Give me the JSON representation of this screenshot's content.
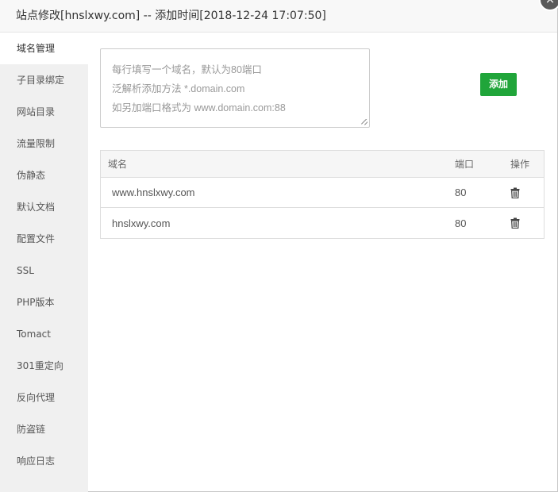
{
  "dialog": {
    "title": "站点修改[hnslxwy.com] -- 添加时间[2018-12-24 17:07:50]",
    "close_icon": "close-icon",
    "close_glyph": "×"
  },
  "sidebar": {
    "items": [
      {
        "label": "域名管理",
        "active": true
      },
      {
        "label": "子目录绑定"
      },
      {
        "label": "网站目录"
      },
      {
        "label": "流量限制"
      },
      {
        "label": "伪静态"
      },
      {
        "label": "默认文档"
      },
      {
        "label": "配置文件"
      },
      {
        "label": "SSL"
      },
      {
        "label": "PHP版本"
      },
      {
        "label": "Tomact"
      },
      {
        "label": "301重定向"
      },
      {
        "label": "反向代理"
      },
      {
        "label": "防盗链"
      },
      {
        "label": "响应日志"
      }
    ]
  },
  "domain_input": {
    "placeholder_lines": [
      "每行填写一个域名，默认为80端口",
      "泛解析添加方法 *.domain.com",
      "如另加端口格式为 www.domain.com:88"
    ],
    "value": ""
  },
  "add_button": {
    "label": "添加",
    "color": "#20a53a"
  },
  "table": {
    "headers": {
      "domain": "域名",
      "port": "端口",
      "action": "操作"
    },
    "rows": [
      {
        "domain": "www.hnslxwy.com",
        "port": "80",
        "action_icon": "trash-icon"
      },
      {
        "domain": "hnslxwy.com",
        "port": "80",
        "action_icon": "trash-icon"
      }
    ]
  }
}
